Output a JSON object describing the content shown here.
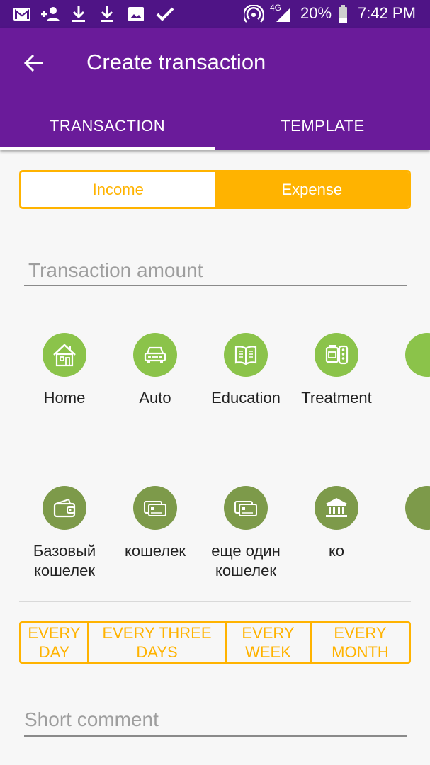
{
  "status_bar": {
    "network": "4G",
    "battery": "20%",
    "time": "7:42 PM"
  },
  "app_bar": {
    "title": "Create transaction"
  },
  "tabs": [
    {
      "label": "TRANSACTION",
      "active": true
    },
    {
      "label": "TEMPLATE",
      "active": false
    }
  ],
  "type_toggle": {
    "income": "Income",
    "expense": "Expense",
    "selected": "Expense"
  },
  "amount": {
    "placeholder": "Transaction amount",
    "value": ""
  },
  "categories": [
    {
      "label": "Home",
      "icon": "house-icon"
    },
    {
      "label": "Auto",
      "icon": "car-icon"
    },
    {
      "label": "Education",
      "icon": "book-icon"
    },
    {
      "label": "Treatment",
      "icon": "medicine-icon"
    }
  ],
  "wallets": [
    {
      "label": "Базовый кошелек",
      "icon": "wallet-icon"
    },
    {
      "label": "кошелек",
      "icon": "card-icon"
    },
    {
      "label": "еще один кошелек",
      "icon": "card-icon"
    },
    {
      "label": "ко",
      "icon": "bank-icon"
    }
  ],
  "periods": [
    "EVERY DAY",
    "EVERY THREE DAYS",
    "EVERY WEEK",
    "EVERY MONTH"
  ],
  "comment": {
    "placeholder": "Short comment",
    "value": ""
  },
  "colors": {
    "status_bar": "#4f1486",
    "app_bar": "#6a1b9a",
    "accent": "#ffb300",
    "category_icon": "#8bc34a",
    "wallet_icon": "#7d9a4a"
  }
}
